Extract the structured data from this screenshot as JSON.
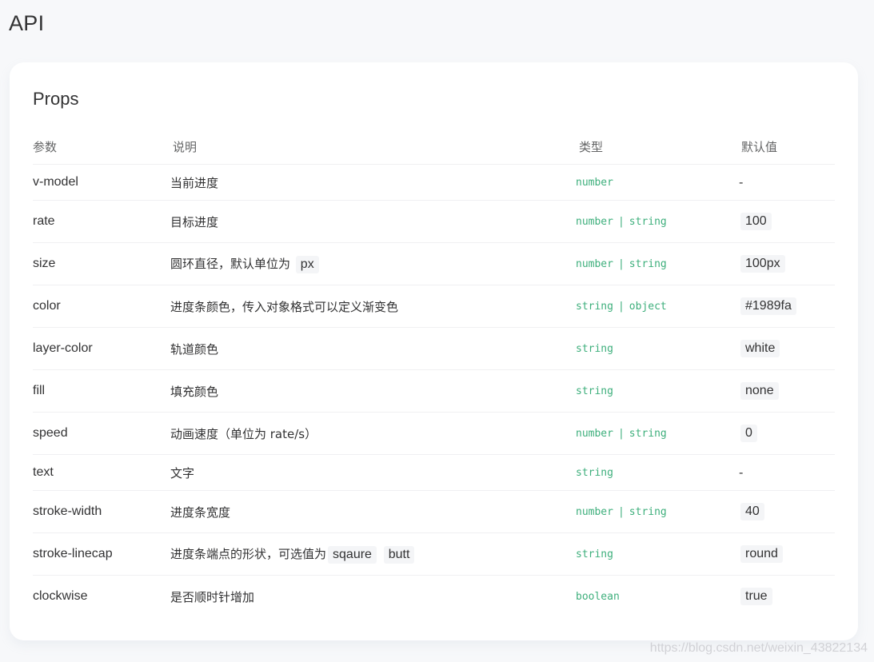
{
  "page": {
    "title": "API"
  },
  "section": {
    "title": "Props"
  },
  "table": {
    "headers": [
      "参数",
      "说明",
      "类型",
      "默认值"
    ],
    "rows": [
      {
        "name": "v-model",
        "desc": [
          "当前进度"
        ],
        "type": [
          "number"
        ],
        "default": "-"
      },
      {
        "name": "rate",
        "desc": [
          "目标进度"
        ],
        "type": [
          "number",
          "string"
        ],
        "default": "100"
      },
      {
        "name": "size",
        "desc": [
          "圆环直径，默认单位为",
          "px"
        ],
        "type": [
          "number",
          "string"
        ],
        "default": "100px"
      },
      {
        "name": "color",
        "desc": [
          "进度条颜色，传入对象格式可以定义渐变色"
        ],
        "type": [
          "string",
          "object"
        ],
        "default": "#1989fa"
      },
      {
        "name": "layer-color",
        "desc": [
          "轨道颜色"
        ],
        "type": [
          "string"
        ],
        "default": "white"
      },
      {
        "name": "fill",
        "desc": [
          "填充颜色"
        ],
        "type": [
          "string"
        ],
        "default": "none"
      },
      {
        "name": "speed",
        "desc": [
          "动画速度（单位为 rate/s）"
        ],
        "type": [
          "number",
          "string"
        ],
        "default": "0"
      },
      {
        "name": "text",
        "desc": [
          "文字"
        ],
        "type": [
          "string"
        ],
        "default": "-"
      },
      {
        "name": "stroke-width",
        "desc": [
          "进度条宽度"
        ],
        "type": [
          "number",
          "string"
        ],
        "default": "40"
      },
      {
        "name": "stroke-linecap",
        "desc": [
          "进度条端点的形状，可选值为",
          "sqaure",
          "butt"
        ],
        "type": [
          "string"
        ],
        "default": "round"
      },
      {
        "name": "clockwise",
        "desc": [
          "是否顺时针增加"
        ],
        "type": [
          "boolean"
        ],
        "default": "true"
      }
    ]
  },
  "watermark": "https://blog.csdn.net/weixin_43822134",
  "colors": {
    "type_green": "#3eaf7c",
    "background": "#f7f8fa",
    "card": "#ffffff"
  }
}
